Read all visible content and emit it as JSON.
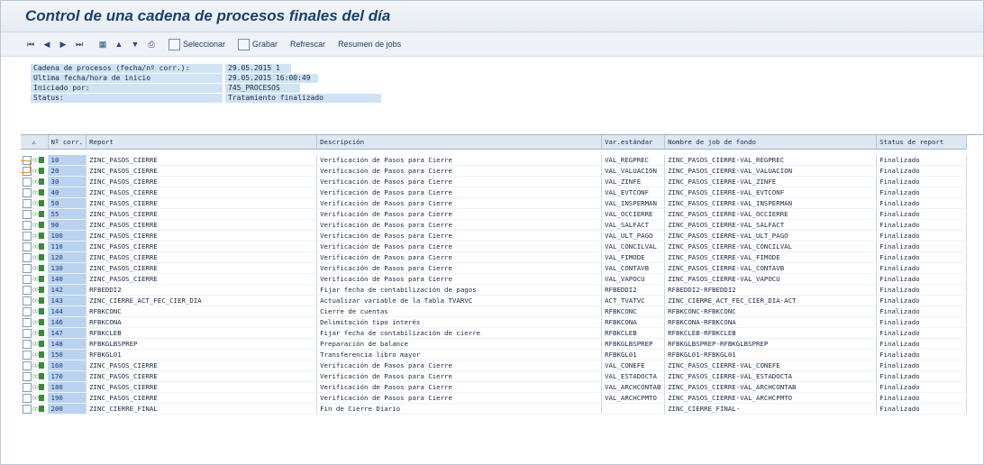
{
  "title": "Control de una cadena de procesos finales del día",
  "toolbar": {
    "nav_icons": [
      "first-page-icon",
      "prev-page-icon",
      "next-page-icon",
      "last-page-icon",
      "select-all-icon",
      "details-icon",
      "filter-icon",
      "export-icon"
    ],
    "seleccionar_label": "Seleccionar",
    "grabar_label": "Grabar",
    "refrescar_label": "Refrescar",
    "resumen_label": "Resumen de jobs"
  },
  "info": [
    {
      "label": "Cadena de procesos (fecha/nº corr.):",
      "value": "29.05.2015   1"
    },
    {
      "label": "Última fecha/hora de inicio",
      "value": "29.05.2015 16:00:49"
    },
    {
      "label": "Iniciado por:",
      "value": "745_PROCESOS"
    },
    {
      "label": "Status:",
      "value": "Tratamiento finalizado"
    }
  ],
  "table": {
    "headers": {
      "warn": "⚠",
      "nr": "Nº corr.",
      "report": "Report",
      "desc": "Descripción",
      "var": "Var.estándar",
      "job": "Nombre de job de fondo",
      "status": "Status de report"
    },
    "rows": [
      {
        "nr": "10",
        "report": "ZINC_PASOS_CIERRE",
        "desc": "Verificación de Pasos para Cierre",
        "var": "VAL_REGPREC",
        "job": "ZINC_PASOS_CIERRE-VAL_REGPREC",
        "status": "Finalizado"
      },
      {
        "nr": "20",
        "report": "ZINC_PASOS_CIERRE",
        "desc": "Verificación de Pasos para Cierre",
        "var": "VAL_VALUACION",
        "job": "ZINC_PASOS_CIERRE-VAL_VALUACION",
        "status": "Finalizado"
      },
      {
        "nr": "30",
        "report": "ZINC_PASOS_CIERRE",
        "desc": "Verificación de Pasos para Cierre",
        "var": "VAL_ZINFE",
        "job": "ZINC_PASOS_CIERRE-VAL_ZINFE",
        "status": "Finalizado"
      },
      {
        "nr": "40",
        "report": "ZINC_PASOS_CIERRE",
        "desc": "Verificación de Pasos para Cierre",
        "var": "VAL_EVTCONF",
        "job": "ZINC_PASOS_CIERRE-VAL_EVTCONF",
        "status": "Finalizado"
      },
      {
        "nr": "50",
        "report": "ZINC_PASOS_CIERRE",
        "desc": "Verificación de Pasos para Cierre",
        "var": "VAL_INSPERMAN",
        "job": "ZINC_PASOS_CIERRE-VAL_INSPERMAN",
        "status": "Finalizado"
      },
      {
        "nr": "55",
        "report": "ZINC_PASOS_CIERRE",
        "desc": "Verificación de Pasos para Cierre",
        "var": "VAL_OCCIERRE",
        "job": "ZINC_PASOS_CIERRE-VAL_OCCIERRE",
        "status": "Finalizado"
      },
      {
        "nr": "90",
        "report": "ZINC_PASOS_CIERRE",
        "desc": "Verificación de Pasos para Cierre",
        "var": "VAL_SALFACT",
        "job": "ZINC_PASOS_CIERRE-VAL_SALFACT",
        "status": "Finalizado"
      },
      {
        "nr": "100",
        "report": "ZINC_PASOS_CIERRE",
        "desc": "Verificación de Pasos para Cierre",
        "var": "VAL_ULT_PAGO",
        "job": "ZINC_PASOS_CIERRE-VAL_ULT_PAGO",
        "status": "Finalizado"
      },
      {
        "nr": "110",
        "report": "ZINC_PASOS_CIERRE",
        "desc": "Verificación de Pasos para Cierre",
        "var": "VAL_CONCILVAL",
        "job": "ZINC_PASOS_CIERRE-VAL_CONCILVAL",
        "status": "Finalizado"
      },
      {
        "nr": "120",
        "report": "ZINC_PASOS_CIERRE",
        "desc": "Verificación de Pasos para Cierre",
        "var": "VAL_FIMODE",
        "job": "ZINC_PASOS_CIERRE-VAL_FIMODE",
        "status": "Finalizado"
      },
      {
        "nr": "130",
        "report": "ZINC_PASOS_CIERRE",
        "desc": "Verificación de Pasos para Cierre",
        "var": "VAL_CONTAVB",
        "job": "ZINC_PASOS_CIERRE-VAL_CONTAVB",
        "status": "Finalizado"
      },
      {
        "nr": "140",
        "report": "ZINC_PASOS_CIERRE",
        "desc": "Verificación de Pasos para Cierre",
        "var": "VAL_VAPOCU",
        "job": "ZINC_PASOS_CIERRE-VAL_VAPOCU",
        "status": "Finalizado"
      },
      {
        "nr": "142",
        "report": "RFBEDDI2",
        "desc": "Fijar fecha de contabilización de pagos",
        "var": "RFBEDDI2",
        "job": "RFBEDDI2-RFBEDDI2",
        "status": "Finalizado"
      },
      {
        "nr": "143",
        "report": "ZINC_CIERRE_ACT_FEC_CIER_DIA",
        "desc": "Actualizar variable de la Tabla TVARVC",
        "var": "ACT_TVATVC",
        "job": "ZINC_CIERRE_ACT_FEC_CIER_DIA-ACT",
        "status": "Finalizado"
      },
      {
        "nr": "144",
        "report": "RFBKCONC",
        "desc": "Cierre de cuentas",
        "var": "RFBKCONC",
        "job": "RFBKCONC-RFBKCONC",
        "status": "Finalizado"
      },
      {
        "nr": "146",
        "report": "RFBKCONA",
        "desc": "Delimitación tipo interés",
        "var": "RFBKCONA",
        "job": "RFBKCONA-RFBKCONA",
        "status": "Finalizado"
      },
      {
        "nr": "147",
        "report": "RFBKCLEB",
        "desc": "Fijar fecha de contabilización de cierre",
        "var": "RFBKCLEB",
        "job": "RFBKCLEB-RFBKCLEB",
        "status": "Finalizado"
      },
      {
        "nr": "148",
        "report": "RFBKGLBSPREP",
        "desc": "Preparación de balance",
        "var": "RFBKGLBSPREP",
        "job": "RFBKGLBSPREP-RFBKGLBSPREP",
        "status": "Finalizado"
      },
      {
        "nr": "150",
        "report": "RFBKGL01",
        "desc": "Transferencia libro mayor",
        "var": "RFBKGL01",
        "job": "RFBKGL01-RFBKGL01",
        "status": "Finalizado"
      },
      {
        "nr": "160",
        "report": "ZINC_PASOS_CIERRE",
        "desc": "Verificación de Pasos para Cierre",
        "var": "VAL_CONEFE",
        "job": "ZINC_PASOS_CIERRE-VAL_CONEFE",
        "status": "Finalizado"
      },
      {
        "nr": "170",
        "report": "ZINC_PASOS_CIERRE",
        "desc": "Verificación de Pasos para Cierre",
        "var": "VAL_ESTADOCTA",
        "job": "ZINC_PASOS_CIERRE-VAL_ESTADOCTA",
        "status": "Finalizado"
      },
      {
        "nr": "180",
        "report": "ZINC_PASOS_CIERRE",
        "desc": "Verificación de Pasos para Cierre",
        "var": "VAL_ARCHCONTAB",
        "job": "ZINC_PASOS_CIERRE-VAL_ARCHCONTAB",
        "status": "Finalizado"
      },
      {
        "nr": "190",
        "report": "ZINC_PASOS_CIERRE",
        "desc": "Verificación de Pasos para Cierre",
        "var": "VAL_ARCHCPMTO",
        "job": "ZINC_PASOS_CIERRE-VAL_ARCHCPMTO",
        "status": "Finalizado"
      },
      {
        "nr": "200",
        "report": "ZINC_CIERRE_FINAL",
        "desc": "Fin de Cierre Diario",
        "var": "",
        "job": "ZINC_CIERRE_FINAL-",
        "status": "Finalizado"
      }
    ]
  },
  "colors": {
    "accent": "#1b3f6e",
    "header_bg": "#dde8f3",
    "info_bg": "#cfe3f4",
    "nr_bg": "#b9d3f0",
    "status_ok": "#3a8a3a"
  }
}
